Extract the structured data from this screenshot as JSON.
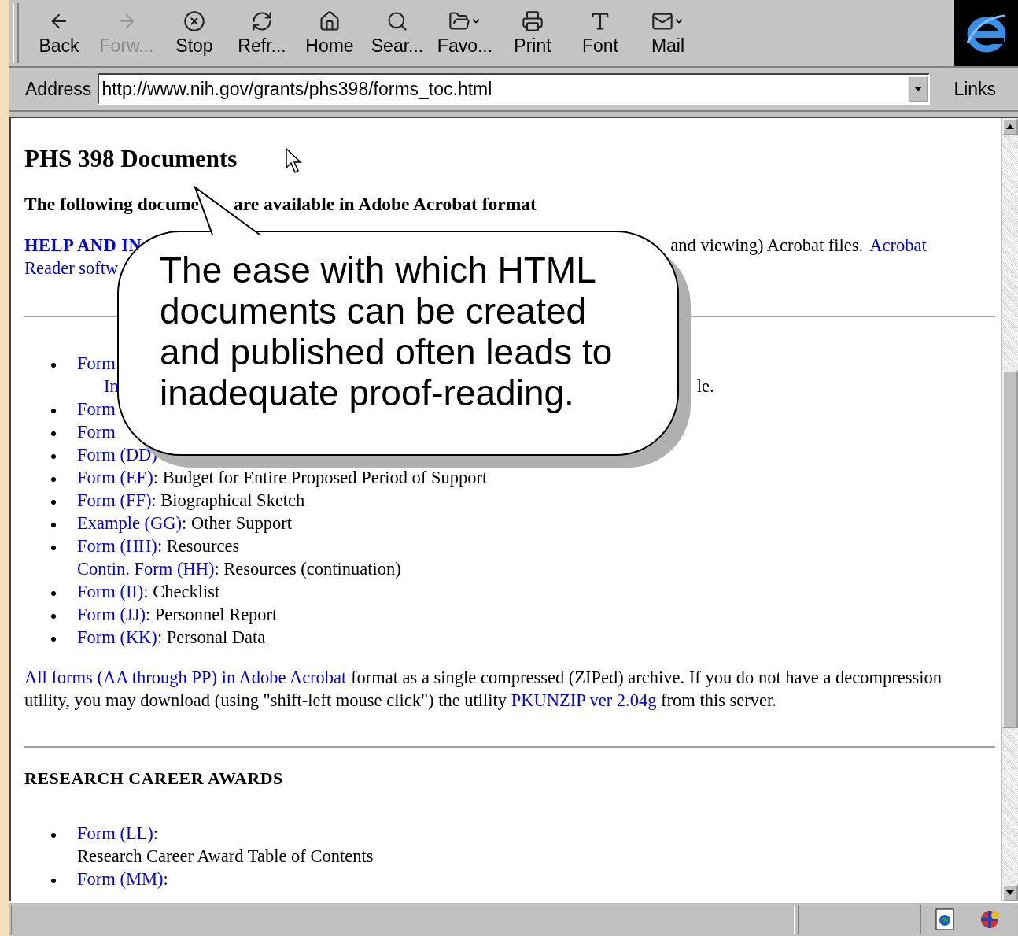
{
  "toolbar": {
    "buttons": [
      {
        "label": "Back",
        "disabled": false
      },
      {
        "label": "Forw...",
        "disabled": true
      },
      {
        "label": "Stop",
        "disabled": false
      },
      {
        "label": "Refr...",
        "disabled": false
      },
      {
        "label": "Home",
        "disabled": false
      },
      {
        "label": "Sear...",
        "disabled": false
      },
      {
        "label": "Favo...",
        "disabled": false
      },
      {
        "label": "Print",
        "disabled": false
      },
      {
        "label": "Font",
        "disabled": false
      },
      {
        "label": "Mail",
        "disabled": false
      }
    ]
  },
  "address_bar": {
    "label": "Address",
    "value": "http://www.nih.gov/grants/phs398/forms_toc.html",
    "links_label": "Links"
  },
  "page": {
    "title": "PHS 398 Documents",
    "intro": {
      "start": "The following docume",
      "end": "are available in Adobe Acrobat format"
    },
    "help": {
      "link_start": "HELP AND IN",
      "text_end": "and viewing) Acrobat files.",
      "link_end": "Acrobat",
      "line2_link": "Reader softw"
    },
    "forms": [
      {
        "kind": "bullet",
        "link": "Form"
      },
      {
        "kind": "split",
        "link": "In",
        "text": "le."
      },
      {
        "kind": "bullet",
        "link": "Form"
      },
      {
        "kind": "bullet",
        "link": "Form"
      },
      {
        "kind": "bullet",
        "link": "Form (DD)"
      },
      {
        "kind": "bullet",
        "link": "Form (EE)",
        "text": ": Budget for Entire Proposed Period of Support"
      },
      {
        "kind": "bullet",
        "link": "Form (FF)",
        "text": ": Biographical Sketch"
      },
      {
        "kind": "bullet",
        "link": "Example (GG)",
        "text": ": Other Support"
      },
      {
        "kind": "bullet",
        "link": "Form (HH)",
        "text": ": Resources"
      },
      {
        "kind": "sub",
        "link": "Contin. Form (HH)",
        "text": ": Resources (continuation)"
      },
      {
        "kind": "bullet",
        "link": "Form (II)",
        "text": ": Checklist"
      },
      {
        "kind": "bullet",
        "link": "Form (JJ)",
        "text": ": Personnel Report"
      },
      {
        "kind": "bullet",
        "link": "Form (KK)",
        "text": ": Personal Data"
      }
    ],
    "archive": {
      "link": "All forms (AA through PP) in Adobe Acrobat",
      "text": " format as a single compressed (ZIPed) archive. If you do not have a decompression utility, you may download (using \"shift-left mouse click\") the utility ",
      "link2": "PKUNZIP ver 2.04g",
      "text2": " from this server."
    },
    "section_title": "RESEARCH CAREER AWARDS",
    "awards": [
      {
        "link": "Form (LL)",
        "text": ":",
        "description": "Research Career Award Table of Contents"
      },
      {
        "link": "Form (MM)",
        "text": ":"
      }
    ]
  },
  "callout": {
    "text": "The ease with which HTML documents can be created and published often leads to inadequate proof-reading."
  }
}
